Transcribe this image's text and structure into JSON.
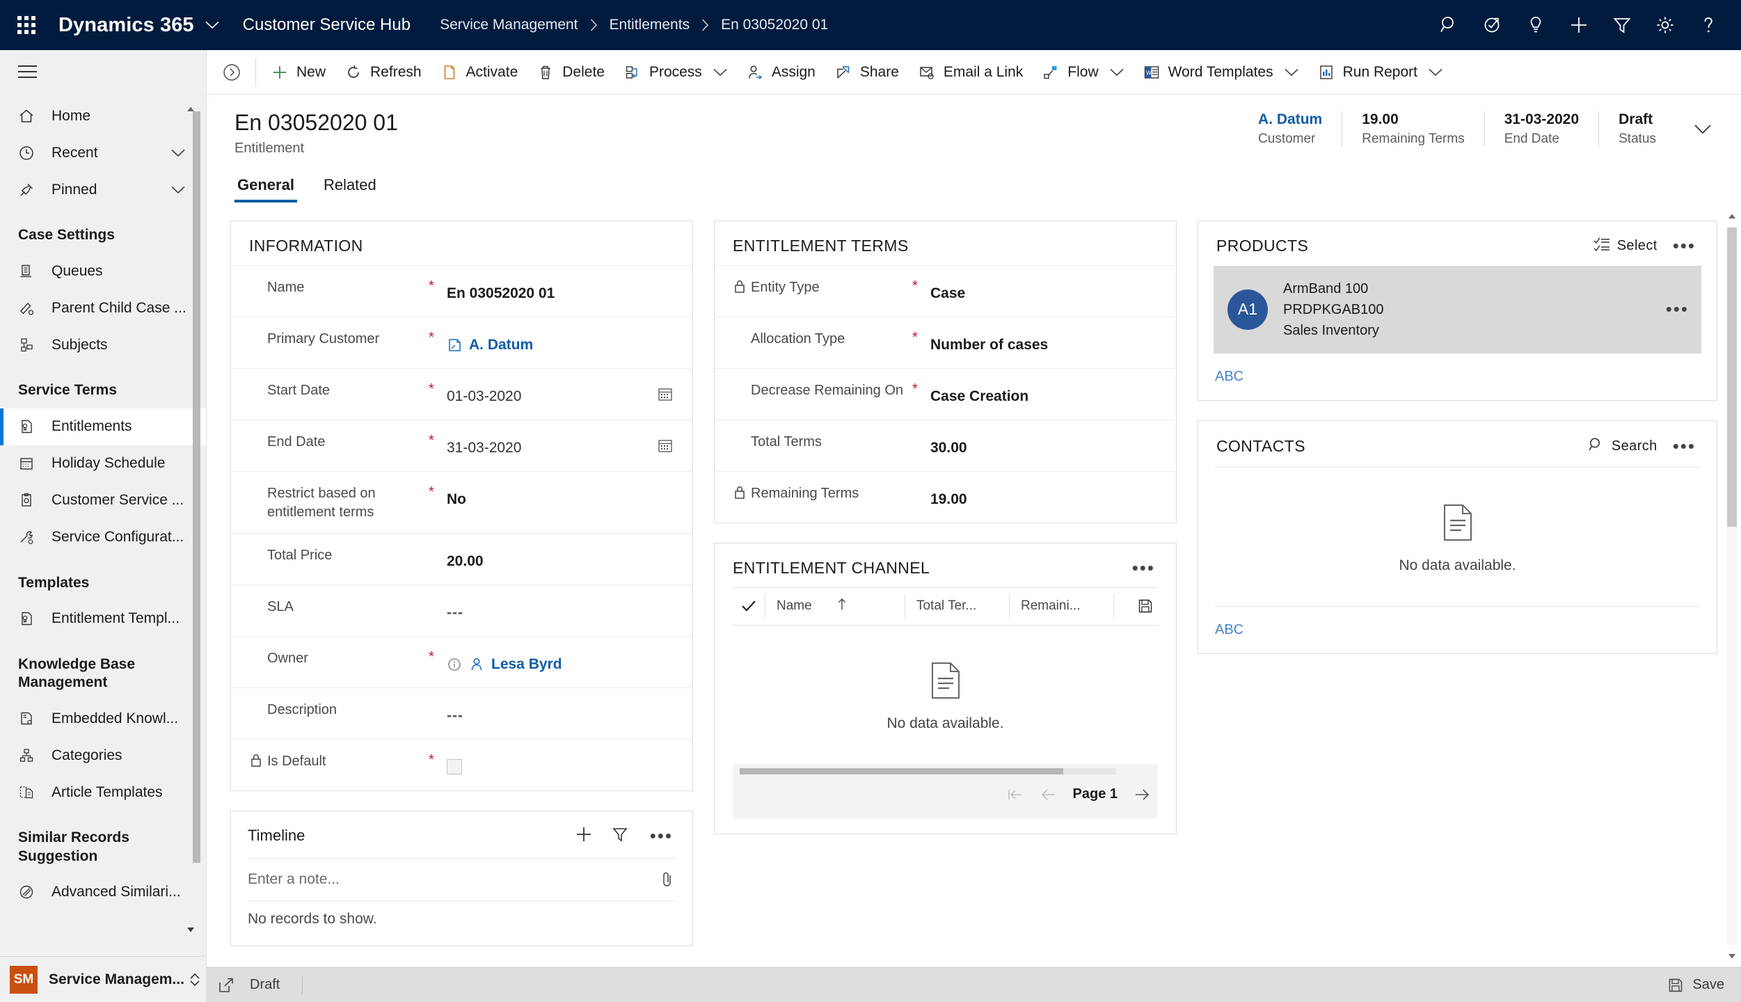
{
  "topbar": {
    "waffle_label": "app-launcher",
    "brand": "Dynamics 365",
    "app_name": "Customer Service Hub",
    "breadcrumb": [
      "Service Management",
      "Entitlements",
      "En 03052020 01"
    ],
    "icons": [
      "search-icon",
      "assistant-icon",
      "insights-icon",
      "quick-create-icon",
      "filter-icon",
      "settings-icon",
      "help-icon"
    ]
  },
  "sidebar": {
    "top_items": [
      {
        "label": "Home",
        "icon": "home-icon",
        "caret": false
      },
      {
        "label": "Recent",
        "icon": "clock-icon",
        "caret": true
      },
      {
        "label": "Pinned",
        "icon": "pin-icon",
        "caret": true
      }
    ],
    "groups": [
      {
        "title": "Case Settings",
        "items": [
          {
            "label": "Queues",
            "icon": "queue-icon"
          },
          {
            "label": "Parent Child Case ...",
            "icon": "parent-child-case-icon"
          },
          {
            "label": "Subjects",
            "icon": "subjects-icon"
          }
        ]
      },
      {
        "title": "Service Terms",
        "items": [
          {
            "label": "Entitlements",
            "icon": "entitlement-icon",
            "selected": true
          },
          {
            "label": "Holiday Schedule",
            "icon": "calendar-icon"
          },
          {
            "label": "Customer Service ...",
            "icon": "customer-service-icon"
          },
          {
            "label": "Service Configurat...",
            "icon": "service-config-icon"
          }
        ]
      },
      {
        "title": "Templates",
        "items": [
          {
            "label": "Entitlement Templ...",
            "icon": "entitlement-template-icon"
          }
        ]
      },
      {
        "title": "Knowledge Base Management",
        "items": [
          {
            "label": "Embedded Knowl...",
            "icon": "embedded-knowledge-icon"
          },
          {
            "label": "Categories",
            "icon": "categories-icon"
          },
          {
            "label": "Article Templates",
            "icon": "article-template-icon"
          }
        ]
      },
      {
        "title": "Similar Records Suggestion",
        "items": [
          {
            "label": "Advanced Similari...",
            "icon": "advanced-similarity-icon"
          }
        ]
      }
    ],
    "footer": {
      "initials": "SM",
      "label": "Service Managem..."
    }
  },
  "commandbar": {
    "items": [
      {
        "label": "New",
        "icon": "plus-icon",
        "dropdown": false
      },
      {
        "label": "Refresh",
        "icon": "refresh-icon",
        "dropdown": false
      },
      {
        "label": "Activate",
        "icon": "activate-icon",
        "dropdown": false
      },
      {
        "label": "Delete",
        "icon": "trash-icon",
        "dropdown": false
      },
      {
        "label": "Process",
        "icon": "process-icon",
        "dropdown": true
      },
      {
        "label": "Assign",
        "icon": "assign-icon",
        "dropdown": false
      },
      {
        "label": "Share",
        "icon": "share-icon",
        "dropdown": false
      },
      {
        "label": "Email a Link",
        "icon": "email-link-icon",
        "dropdown": false
      },
      {
        "label": "Flow",
        "icon": "flow-icon",
        "dropdown": true
      },
      {
        "label": "Word Templates",
        "icon": "word-template-icon",
        "dropdown": true
      },
      {
        "label": "Run Report",
        "icon": "report-icon",
        "dropdown": true
      }
    ]
  },
  "record": {
    "title": "En 03052020 01",
    "subtitle": "Entitlement",
    "summary": [
      {
        "value": "A. Datum",
        "label": "Customer",
        "is_link": true
      },
      {
        "value": "19.00",
        "label": "Remaining Terms",
        "is_link": false
      },
      {
        "value": "31-03-2020",
        "label": "End Date",
        "is_link": false
      },
      {
        "value": "Draft",
        "label": "Status",
        "is_link": false
      }
    ],
    "tabs": [
      {
        "label": "General",
        "active": true
      },
      {
        "label": "Related",
        "active": false
      }
    ]
  },
  "information_card": {
    "title": "INFORMATION",
    "fields": [
      {
        "label": "Name",
        "required": true,
        "value": "En 03052020 01",
        "style": "bold"
      },
      {
        "label": "Primary Customer",
        "required": true,
        "value": "A. Datum",
        "style": "link",
        "icon": "account-icon"
      },
      {
        "label": "Start Date",
        "required": true,
        "value": "01-03-2020",
        "style": "normal",
        "trailing": "calendar-icon"
      },
      {
        "label": "End Date",
        "required": true,
        "value": "31-03-2020",
        "style": "normal",
        "trailing": "calendar-icon"
      },
      {
        "label": "Restrict based on entitlement terms",
        "required": true,
        "value": "No",
        "style": "bold"
      },
      {
        "label": "Total Price",
        "required": false,
        "value": "20.00",
        "style": "bold"
      },
      {
        "label": "SLA",
        "required": false,
        "value": "---",
        "style": "dashes"
      },
      {
        "label": "Owner",
        "required": true,
        "value": "Lesa Byrd",
        "style": "link",
        "icon": "user-icon",
        "prefix_icon": "info-icon"
      },
      {
        "label": "Description",
        "required": false,
        "value": "---",
        "style": "dashes"
      },
      {
        "label": "Is Default",
        "required": true,
        "value": "",
        "style": "checkbox",
        "locked": true
      }
    ]
  },
  "entitlement_terms_card": {
    "title": "ENTITLEMENT TERMS",
    "fields": [
      {
        "label": "Entity Type",
        "required": true,
        "value": "Case",
        "style": "bold",
        "locked": true
      },
      {
        "label": "Allocation Type",
        "required": true,
        "value": "Number of cases",
        "style": "bold"
      },
      {
        "label": "Decrease Remaining On",
        "required": true,
        "value": "Case Creation",
        "style": "bold"
      },
      {
        "label": "Total Terms",
        "required": false,
        "value": "30.00",
        "style": "bold"
      },
      {
        "label": "Remaining Terms",
        "required": false,
        "value": "19.00",
        "style": "bold",
        "locked": true
      }
    ]
  },
  "entitlement_channel_card": {
    "title": "ENTITLEMENT CHANNEL",
    "columns": [
      "Name",
      "Total Ter...",
      "Remaini..."
    ],
    "sort_column": "Name",
    "empty_message": "No data available.",
    "pager_label": "Page 1",
    "save_icon": "save-icon"
  },
  "timeline_card": {
    "title": "Timeline",
    "note_placeholder": "Enter a note...",
    "empty_message": "No records to show.",
    "actions": [
      "plus-icon",
      "filter-icon",
      "more-icon"
    ]
  },
  "products_panel": {
    "title": "PRODUCTS",
    "action_label": "Select",
    "action_icon": "select-list-icon",
    "items": [
      {
        "initials": "A1",
        "name": "ArmBand 100",
        "code": "PRDPKGAB100",
        "category": "Sales Inventory"
      }
    ],
    "footer_link": "ABC"
  },
  "contacts_panel": {
    "title": "CONTACTS",
    "action_label": "Search",
    "action_icon": "search-icon",
    "empty_message": "No data available.",
    "footer_link": "ABC"
  },
  "statusbar": {
    "status_text": "Draft",
    "expand_icon": "popout-icon",
    "save_label": "Save",
    "save_icon": "save-icon"
  }
}
